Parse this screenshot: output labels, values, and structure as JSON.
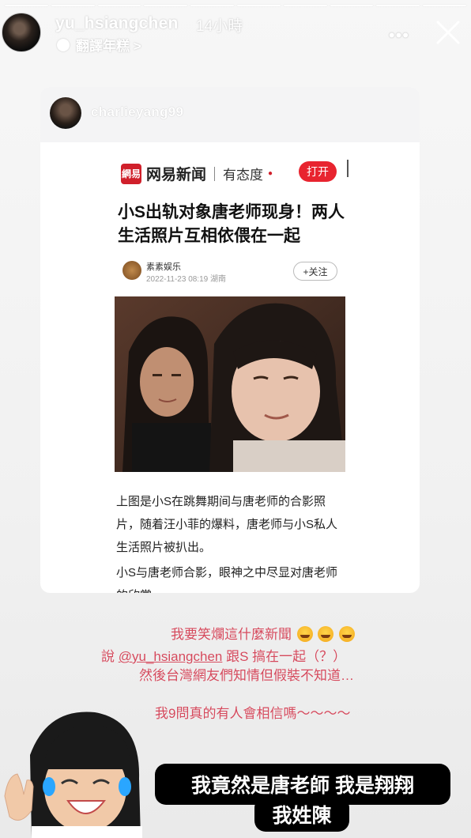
{
  "story": {
    "username": "yu_hsiangchen",
    "time_ago": "14小時",
    "audio_label": "翻譯年糕 >",
    "more_icon": "more-horizontal-icon",
    "close_icon": "close-icon",
    "progress_segments": 10
  },
  "shared_post": {
    "username": "charlieyang99",
    "news_app": {
      "logo_text": "網易",
      "brand": "网易新闻",
      "slogan": "有态度",
      "open_button": "打开"
    },
    "headline": "小S出轨对象唐老师现身！两人生活照片互相依偎在一起",
    "author": {
      "name": "素素娱乐",
      "meta": "2022-11-23 08:19 湖南",
      "follow_button": "+关注"
    },
    "paragraphs": [
      "上图是小S在跳舞期间与唐老师的合影照片，随着汪小菲的爆料，唐老师与小S私人生活照片被扒出。",
      "小S与唐老师合影，眼神之中尽显对唐老师的欣赏。"
    ]
  },
  "comments": {
    "line1": "我要笑爛這什麼新聞",
    "line2_prefix": "說 ",
    "line2_mention": "@yu_hsiangchen",
    "line2_suffix": " 跟S 搞在一起（？）",
    "line3": "然後台灣網友們知情但假裝不知道…",
    "line4": "我9問真的有人會相信嗎～～～～"
  },
  "captions": {
    "line1": "我竟然是唐老師 我是翔翔",
    "line2": "我姓陳"
  },
  "colors": {
    "comment_red": "#d4495c",
    "netease_red": "#d0202b",
    "caption_bg": "#000000"
  }
}
